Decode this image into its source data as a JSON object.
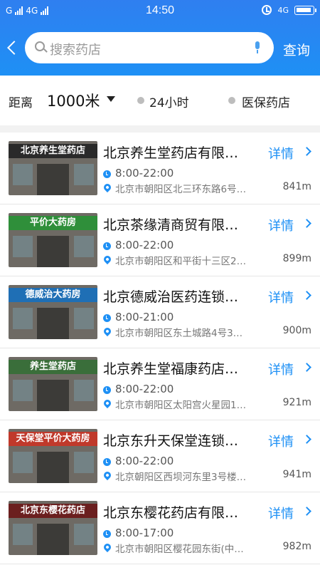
{
  "status_bar": {
    "left": "G",
    "network": "4G",
    "time": "14:50",
    "right_network": "4G"
  },
  "header": {
    "search_placeholder": "搜索药店",
    "query_label": "查询"
  },
  "filter": {
    "distance_label": "距离",
    "distance_value": "1000米",
    "option_24h": "24小时",
    "option_yibao": "医保药店"
  },
  "colors": {
    "accent": "#1e90f5",
    "header_top": "#2f7ff0"
  },
  "stores": [
    {
      "name": "北京养生堂药店有限…",
      "hours": "8:00-22:00",
      "address": "北京市朝阳区北三环东路6号…",
      "distance": "841m",
      "detail": "详情",
      "sign": "北京养生堂药店",
      "sign_color": "#2a2a2a"
    },
    {
      "name": "北京茶缘清商贸有限…",
      "hours": "8:00-22:00",
      "address": "北京市朝阳区和平街十三区2…",
      "distance": "899m",
      "detail": "详情",
      "sign": "平价大药房",
      "sign_color": "#2f8f3a"
    },
    {
      "name": "北京德威治医药连锁…",
      "hours": "8:00-21:00",
      "address": "北京市朝阳区东土城路4号3…",
      "distance": "900m",
      "detail": "详情",
      "sign": "德威治大药房",
      "sign_color": "#1f6fb5"
    },
    {
      "name": "北京养生堂福康药店…",
      "hours": "8:00-22:00",
      "address": "北京市朝阳区太阳宫火星园1…",
      "distance": "921m",
      "detail": "详情",
      "sign": "养生堂药店",
      "sign_color": "#3a6e3a"
    },
    {
      "name": "北京东升天保堂连锁…",
      "hours": "8:00-22:00",
      "address": "北京朝阳区西坝河东里3号楼…",
      "distance": "941m",
      "detail": "详情",
      "sign": "天保堂平价大药房",
      "sign_color": "#c0392b"
    },
    {
      "name": "北京东樱花药店有限…",
      "hours": "8:00-17:00",
      "address": "北京市朝阳区樱花园东街(中…",
      "distance": "982m",
      "detail": "详情",
      "sign": "北京东樱花药店",
      "sign_color": "#6b1f1f"
    }
  ]
}
